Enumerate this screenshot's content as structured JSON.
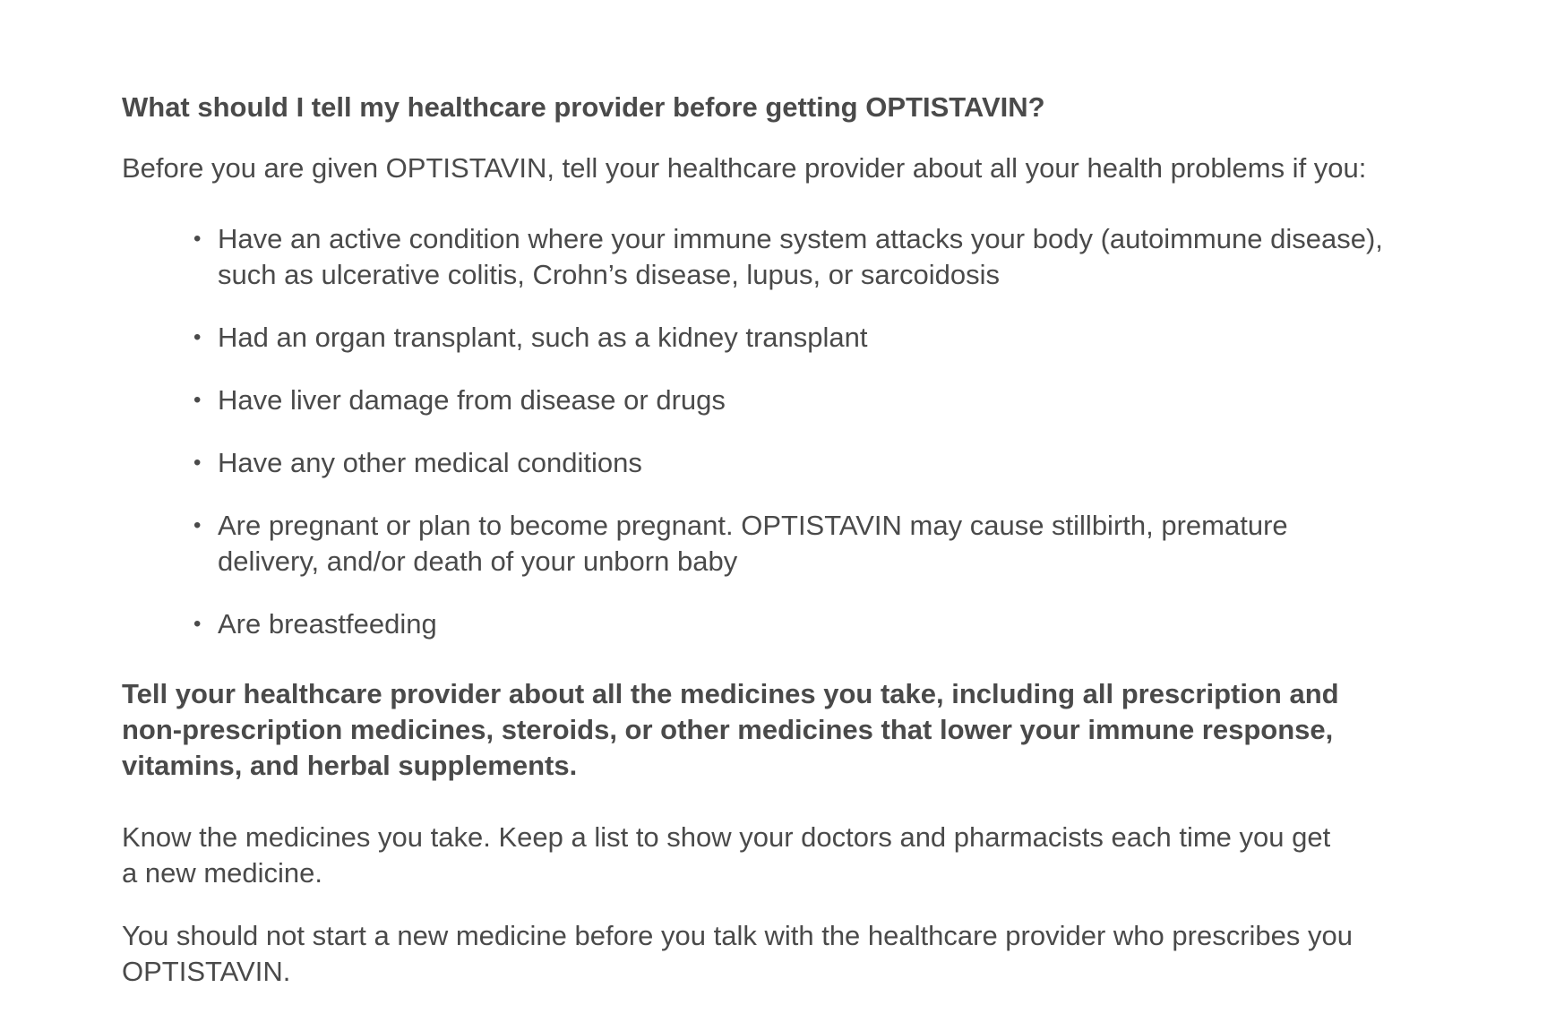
{
  "heading": "What should I tell my healthcare provider before getting OPTISTAVIN?",
  "intro": "Before you are given OPTISTAVIN, tell your healthcare provider about all your health problems if you:",
  "bullet_symbol": "•",
  "bullets": [
    {
      "line1": "Have an active condition where your immune system attacks your body (autoimmune disease),",
      "line2": "such as ulcerative colitis, Crohn’s disease, lupus, or sarcoidosis"
    },
    {
      "line1": "Had an organ transplant, such as a kidney transplant"
    },
    {
      "line1": "Have liver damage from disease or drugs"
    },
    {
      "line1": "Have any other medical conditions"
    },
    {
      "line1": "Are pregnant or plan to become pregnant. OPTISTAVIN may cause stillbirth, premature",
      "line2": "delivery, and/or death of your unborn baby"
    },
    {
      "line1": "Are breastfeeding"
    }
  ],
  "medicines_notice": {
    "line1": "Tell your healthcare provider about all the medicines you take, including all prescription and",
    "line2": "non-prescription medicines, steroids, or other medicines that lower your immune response,",
    "line3": "vitamins, and herbal supplements."
  },
  "know_medicines": {
    "line1": "Know the medicines you take. Keep a list to show your doctors and pharmacists each time you get",
    "line2": "a new medicine."
  },
  "new_medicine": {
    "line1": "You should not start a new medicine before you talk with the healthcare provider who prescribes you",
    "line2": "OPTISTAVIN."
  }
}
